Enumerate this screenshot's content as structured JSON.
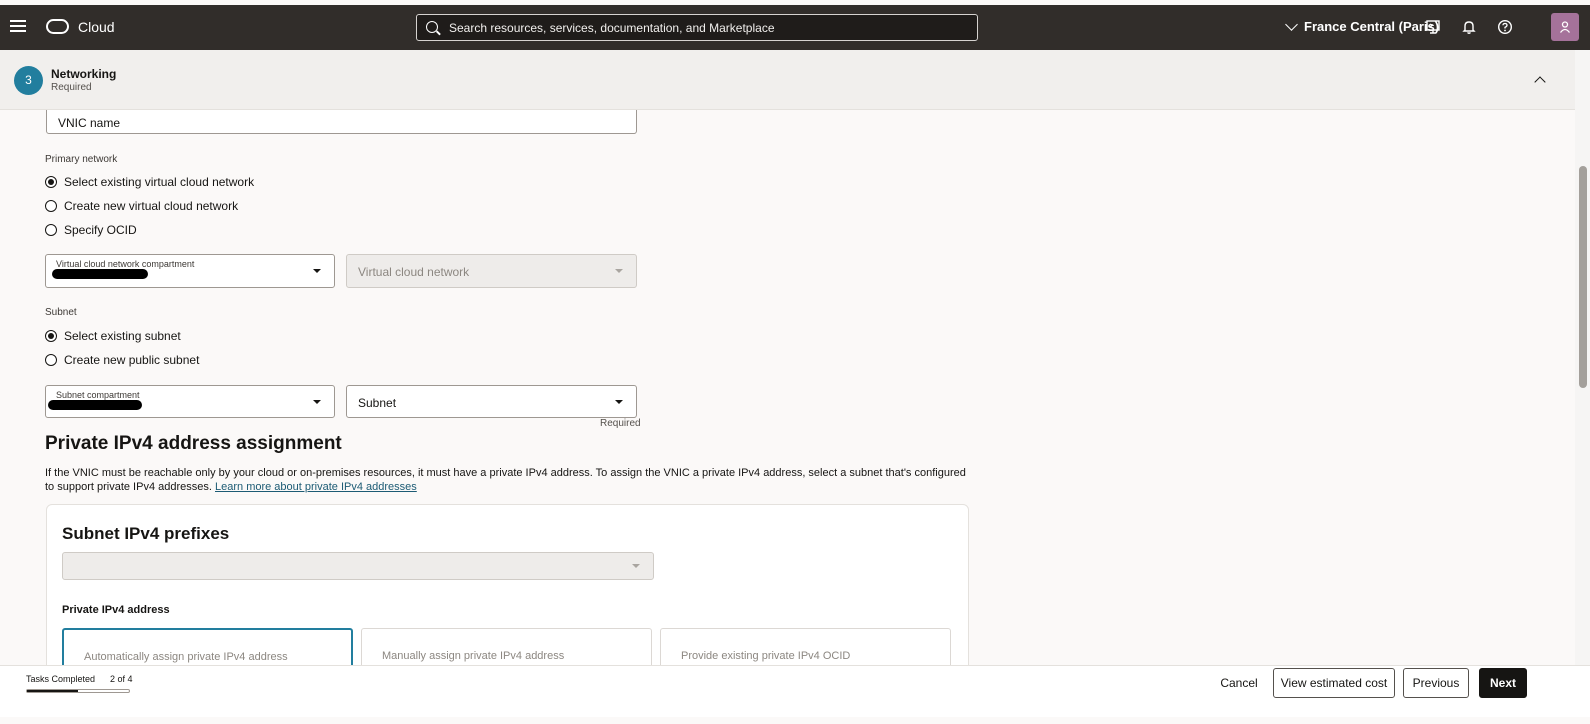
{
  "topbar": {
    "brand": "Cloud",
    "search_placeholder": "Search resources, services, documentation, and Marketplace",
    "region": "France Central (Paris)",
    "icons": [
      "menu-icon",
      "cloud-logo",
      "search-icon",
      "chevron-down-icon",
      "cloud-shell-icon",
      "bell-icon",
      "help-icon",
      "user-icon"
    ]
  },
  "step": {
    "number": "3",
    "title": "Networking",
    "subtitle": "Required"
  },
  "vnic": {
    "name_value": "VNIC name"
  },
  "primary_network": {
    "label": "Primary network",
    "options": [
      {
        "label": "Select existing virtual cloud network",
        "checked": true
      },
      {
        "label": "Create new virtual cloud network",
        "checked": false
      },
      {
        "label": "Specify OCID",
        "checked": false
      }
    ],
    "compartment_label": "Virtual cloud network compartment",
    "vcn_placeholder": "Virtual cloud network"
  },
  "subnet": {
    "label": "Subnet",
    "options": [
      {
        "label": "Select existing subnet",
        "checked": true
      },
      {
        "label": "Create new public subnet",
        "checked": false
      }
    ],
    "compartment_label": "Subnet compartment",
    "subnet_placeholder": "Subnet",
    "required_hint": "Required"
  },
  "private_ipv4": {
    "heading": "Private IPv4 address assignment",
    "description": "If the VNIC must be reachable only by your cloud or on-premises resources, it must have a private IPv4 address. To assign the VNIC a private IPv4 address, select a subnet that's configured to support private IPv4 addresses.",
    "link": "Learn more about private IPv4 addresses",
    "card_title": "Subnet IPv4 prefixes",
    "address_label": "Private IPv4 address",
    "tiles": [
      {
        "label": "Automatically assign private IPv4 address",
        "selected": true
      },
      {
        "label": "Manually assign private IPv4 address",
        "selected": false
      },
      {
        "label": "Provide existing private IPv4 OCID",
        "selected": false
      }
    ]
  },
  "footer": {
    "tasks_label": "Tasks Completed",
    "tasks_count": "2 of 4",
    "progress": 0.5,
    "cancel": "Cancel",
    "view_cost": "View estimated cost",
    "previous": "Previous",
    "next": "Next"
  }
}
